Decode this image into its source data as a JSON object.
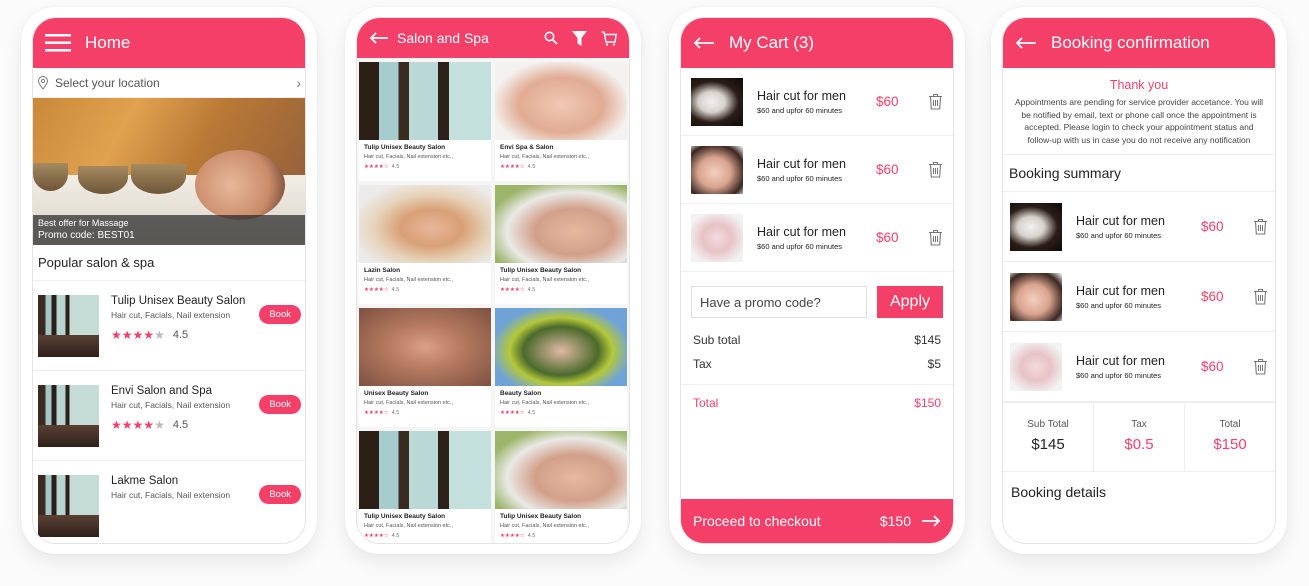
{
  "colors": {
    "accent": "#f43f68",
    "background": "#fbfbfb"
  },
  "home": {
    "title": "Home",
    "menu_icon": "hamburger-menu-icon",
    "location": {
      "placeholder": "Select your location",
      "icon": "location-pin-icon",
      "chevron": "›"
    },
    "banner": {
      "offer": "Best offer for Massage",
      "promo": "Promo code: BEST01"
    },
    "section_title": "Popular salon & spa",
    "salons": [
      {
        "name": "Tulip Unisex Beauty Salon",
        "tags": "Hair cut, Facials, Nail extension",
        "stars": 4,
        "rating": "4.5",
        "book": "Book"
      },
      {
        "name": "Envi Salon and Spa",
        "tags": "Hair cut, Facials, Nail extension",
        "stars": 4,
        "rating": "4.5",
        "book": "Book"
      },
      {
        "name": "Lakme Salon",
        "tags": "Hair cut, Facials, Nail extension",
        "stars": null,
        "rating": null,
        "book": "Book"
      }
    ]
  },
  "listing": {
    "title": "Salon and Spa",
    "icons": [
      "back-arrow-icon",
      "search-icon",
      "filter-icon",
      "cart-icon"
    ],
    "cards": [
      {
        "name": "Tulip Unisex Beauty Salon",
        "tags": "Hair cut, Facials, Nail extension etc.,",
        "stars": "★★★★☆",
        "rating": "4.5"
      },
      {
        "name": "Envi Spa & Salon",
        "tags": "Hair cut, Facials, Nail extension etc.,",
        "stars": "★★★★☆",
        "rating": "4.5"
      },
      {
        "name": "Lazin Salon",
        "tags": "Hair cut, Facials, Nail extension etc.,",
        "stars": "★★★★☆",
        "rating": "4.5"
      },
      {
        "name": "Tulip Unisex Beauty Salon",
        "tags": "Hair cut, Facials, Nail extension etc.,",
        "stars": "★★★★☆",
        "rating": "4.5"
      },
      {
        "name": "Unisex Beauty Salon",
        "tags": "Hair cut, Facials, Nail extension etc.,",
        "stars": "★★★★☆",
        "rating": "4.5"
      },
      {
        "name": "Beauty Salon",
        "tags": "Hair cut, Facials, Nail extension etc.,",
        "stars": "★★★★☆",
        "rating": "4.5"
      },
      {
        "name": "Tulip Unisex Beauty Salon",
        "tags": "Hair cut, Facials, Nail extension etc.,",
        "stars": "★★★★☆",
        "rating": "4.5"
      },
      {
        "name": "Tulip Unisex Beauty Salon",
        "tags": "Hair cut, Facials, Nail extension etc.,",
        "stars": "★★★★☆",
        "rating": "4.5"
      }
    ]
  },
  "cart": {
    "title": "My Cart (3)",
    "items": [
      {
        "name": "Hair cut for men",
        "desc": "$60 and upfor 60 minutes",
        "price": "$60"
      },
      {
        "name": "Hair cut for men",
        "desc": "$60 and upfor 60 minutes",
        "price": "$60"
      },
      {
        "name": "Hair cut for men",
        "desc": "$60 and upfor 60 minutes",
        "price": "$60"
      }
    ],
    "promo_placeholder": "Have a promo code?",
    "apply": "Apply",
    "subtotal_label": "Sub total",
    "subtotal": "$145",
    "tax_label": "Tax",
    "tax": "$5",
    "total_label": "Total",
    "total": "$150",
    "checkout_label": "Proceed to checkout",
    "checkout_amount": "$150"
  },
  "confirmation": {
    "title": "Booking confirmation",
    "thanks": "Thank you",
    "message": "Appointments are pending for service provider accetance. You will be notified by email, text or phone call once the appointment is accepted. Please login to check your appointment status and follow-up with us in case you do not receive any notification",
    "summary_title": "Booking summary",
    "items": [
      {
        "name": "Hair cut for men",
        "desc": "$60 and upfor 60 minutes",
        "price": "$60"
      },
      {
        "name": "Hair cut for men",
        "desc": "$60 and upfor 60 minutes",
        "price": "$60"
      },
      {
        "name": "Hair cut for men",
        "desc": "$60 and upfor 60 minutes",
        "price": "$60"
      }
    ],
    "totals": [
      {
        "label": "Sub Total",
        "value": "$145"
      },
      {
        "label": "Tax",
        "value": "$0.5"
      },
      {
        "label": "Total",
        "value": "$150"
      }
    ],
    "details_title": "Booking details"
  }
}
